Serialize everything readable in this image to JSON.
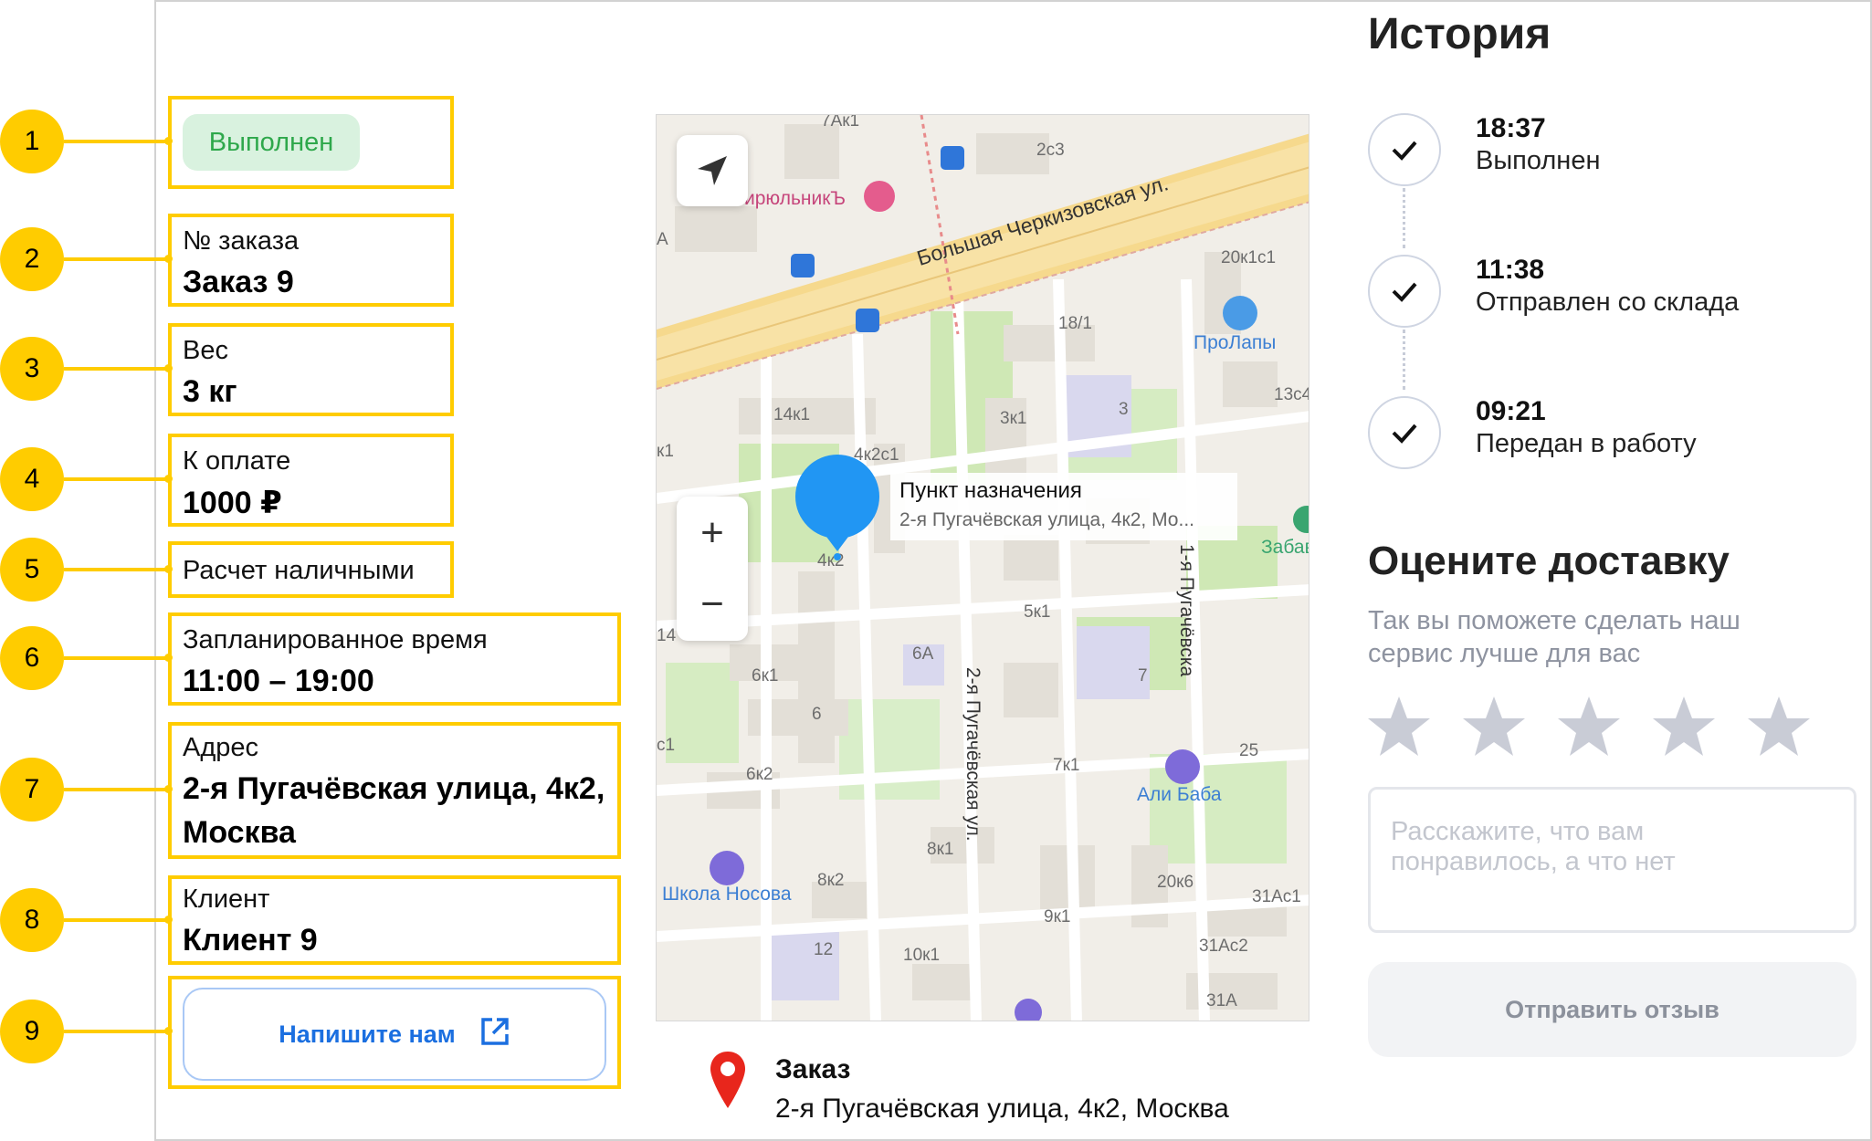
{
  "callouts": [
    "1",
    "2",
    "3",
    "4",
    "5",
    "6",
    "7",
    "8",
    "9"
  ],
  "order": {
    "status": "Выполнен",
    "number_label": "№ заказа",
    "number_value": "Заказ 9",
    "weight_label": "Вес",
    "weight_value": "3 кг",
    "payment_label": "К оплате",
    "payment_value": "1000 ₽",
    "payment_method": "Расчет наличными",
    "scheduled_label": "Запланированное время",
    "scheduled_value": "11:00 – 19:00",
    "address_label": "Адрес",
    "address_line1": "2-я Пугачёвская улица, 4к2,",
    "address_line2": "Москва",
    "client_label": "Клиент",
    "client_value": "Клиент 9",
    "contact_button": "Напишите нам"
  },
  "map": {
    "destination_title": "Пункт назначения",
    "destination_address": "2-я Пугачёвская улица, 4к2, Мо...",
    "zoom_in": "+",
    "zoom_out": "−",
    "streets": {
      "bolshaya_cherkizovskaya": "Большая Черкизовская ул.",
      "pugachevskaya_2": "2-я Пугачёвская ул.",
      "pugachevskaya_1": "1-я Пугачёвска"
    },
    "pois": {
      "pirulnik": "ирюльникЪ",
      "prolapy": "ПроЛапы",
      "ali_baba": "Али Баба",
      "shkola_nosova": "Школа Носова",
      "zabava": "Забав"
    },
    "building_labels": [
      "7Ак1",
      "2с3",
      "20к1с1",
      "18/1",
      "13с4",
      "14к1",
      "3к1",
      "3",
      "4к2с1",
      "4к2",
      "5к1",
      "6А",
      "6к1",
      "6",
      "7",
      "6к2",
      "7к1",
      "25",
      "8к1",
      "8к2",
      "20к6",
      "31Ас1",
      "9к1",
      "12",
      "10к1",
      "31Ас2",
      "31А",
      "А",
      "с1",
      "14",
      "к1"
    ]
  },
  "order_footer": {
    "title": "Заказ",
    "address": "2-я Пугачёвская улица, 4к2, Москва"
  },
  "history": {
    "title": "История",
    "events": [
      {
        "time": "18:37",
        "text": "Выполнен"
      },
      {
        "time": "11:38",
        "text": "Отправлен со склада"
      },
      {
        "time": "09:21",
        "text": "Передан в работу"
      }
    ]
  },
  "rating": {
    "title": "Оцените доставку",
    "subtitle_line1": "Так вы поможете сделать наш",
    "subtitle_line2": "сервис лучше для вас",
    "stars_total": 5,
    "stars_selected": 0,
    "review_placeholder_line1": "Расскажите, что вам",
    "review_placeholder_line2": "понравилось, а что нет",
    "submit_label": "Отправить отзыв"
  },
  "colors": {
    "callout": "#ffcc00",
    "status_bg": "#d9f2df",
    "status_text": "#2ea84b",
    "link": "#1b6fe0",
    "map_pin": "#2196f3",
    "order_pin": "#e8261c",
    "star_inactive": "#c9ccd6"
  }
}
